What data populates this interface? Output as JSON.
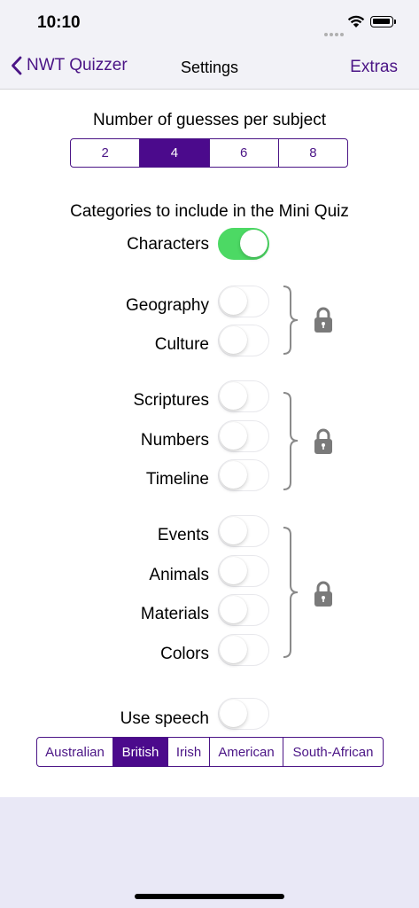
{
  "status": {
    "time": "10:10"
  },
  "nav": {
    "back_label": "NWT Quizzer",
    "title": "Settings",
    "right_label": "Extras"
  },
  "guesses": {
    "title": "Number of guesses per subject",
    "options": [
      "2",
      "4",
      "6",
      "8"
    ],
    "selected": "4"
  },
  "categories": {
    "title": "Categories to include in the Mini Quiz",
    "characters": {
      "label": "Characters",
      "on": true
    },
    "group1": [
      {
        "label": "Geography",
        "on": false
      },
      {
        "label": "Culture",
        "on": false
      }
    ],
    "group2": [
      {
        "label": "Scriptures",
        "on": false
      },
      {
        "label": "Numbers",
        "on": false
      },
      {
        "label": "Timeline",
        "on": false
      }
    ],
    "group3": [
      {
        "label": "Events",
        "on": false
      },
      {
        "label": "Animals",
        "on": false
      },
      {
        "label": "Materials",
        "on": false
      },
      {
        "label": "Colors",
        "on": false
      }
    ]
  },
  "speech": {
    "label": "Use speech",
    "on": false
  },
  "accents": {
    "options": [
      "Australian",
      "British",
      "Irish",
      "American",
      "South-African"
    ],
    "selected": "British"
  },
  "colors": {
    "accent": "#4b1586",
    "selected_segment": "#4b0a8c",
    "switch_on": "#4cd964",
    "lock": "#7a7a7a",
    "brace": "#8a8a8a"
  }
}
